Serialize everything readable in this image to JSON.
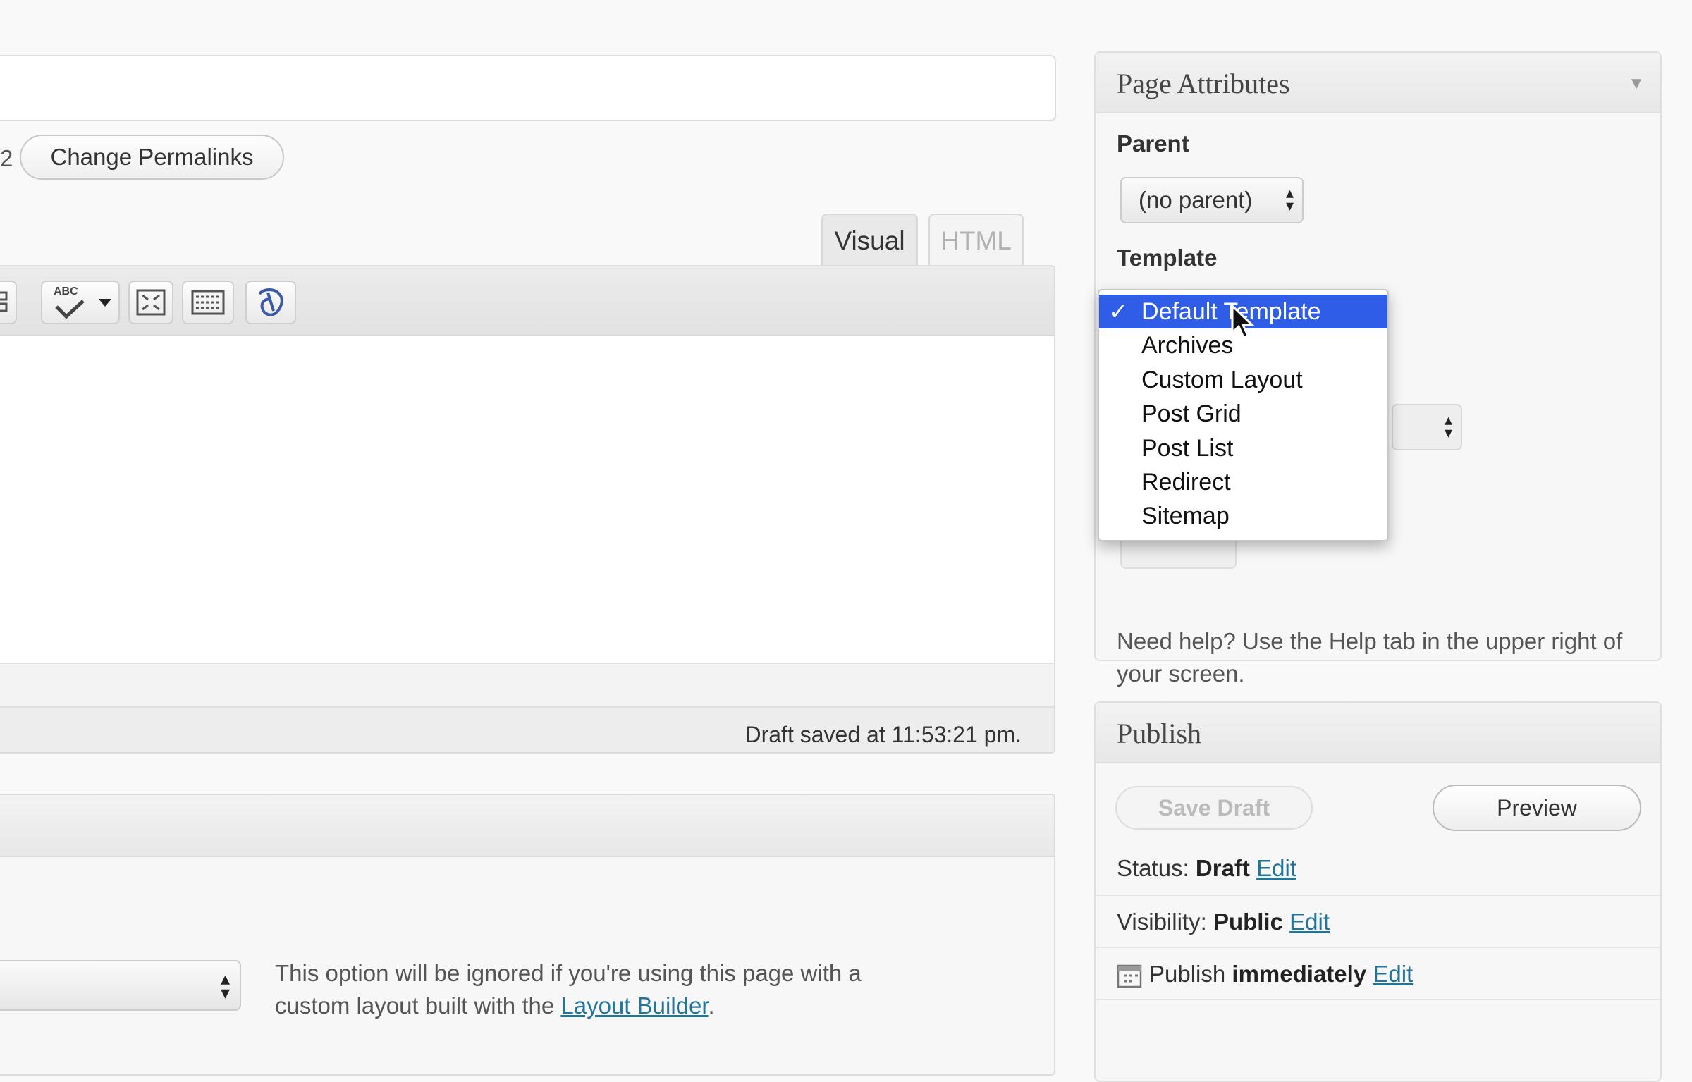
{
  "editor": {
    "permalink_fragment": "2",
    "change_permalinks_label": "Change Permalinks",
    "tabs": {
      "visual": "Visual",
      "html": "HTML"
    },
    "spellcheck_label": "ABC",
    "draft_saved": "Draft saved at 11:53:21 pm."
  },
  "lower_box": {
    "note_text": "This option will be ignored if you're using this page with a custom layout built with the ",
    "note_link": "Layout Builder",
    "note_end": "."
  },
  "page_attributes": {
    "title": "Page Attributes",
    "parent_label": "Parent",
    "parent_value": "(no parent)",
    "template_label": "Template",
    "template_options": [
      "Default Template",
      "Archives",
      "Custom Layout",
      "Post Grid",
      "Post List",
      "Redirect",
      "Sitemap"
    ],
    "help_text": "Need help? Use the Help tab in the upper right of your screen."
  },
  "publish": {
    "title": "Publish",
    "save_draft_label": "Save Draft",
    "preview_label": "Preview",
    "status_label": "Status:",
    "status_value": "Draft",
    "visibility_label": "Visibility:",
    "visibility_value": "Public",
    "publish_label": "Publish",
    "publish_value": "immediately",
    "edit_label": "Edit"
  },
  "icons": {
    "collapse": "triangle-down-icon",
    "toolbar": [
      "pagebreak-icon",
      "spellcheck-icon",
      "dropdown-arrow-icon",
      "fullscreen-icon",
      "kitchen-sink-icon",
      "plugin-icon"
    ],
    "calendar": "calendar-icon",
    "cursor": "mouse-cursor-icon"
  },
  "colors": {
    "link": "#21759b",
    "selection": "#2f5de8"
  }
}
